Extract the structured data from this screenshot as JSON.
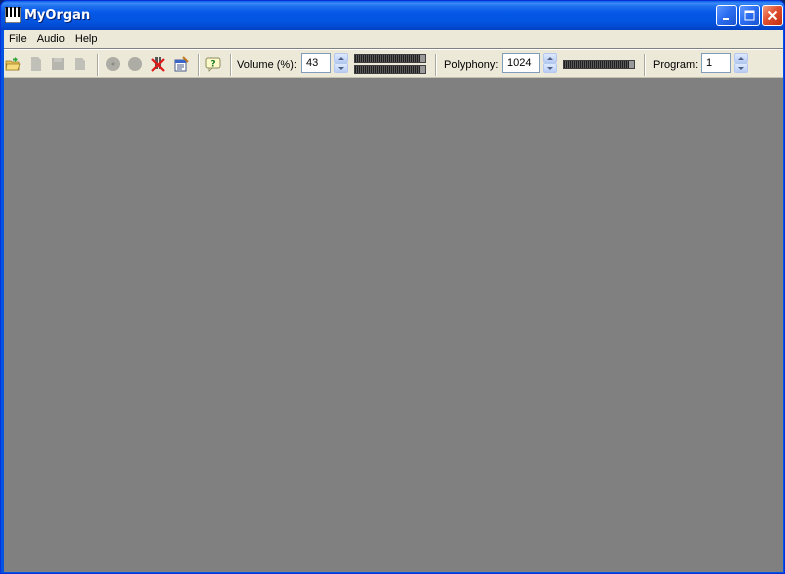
{
  "window": {
    "title": "MyOrgan"
  },
  "menu": {
    "items": [
      "File",
      "Audio",
      "Help"
    ]
  },
  "toolbar": {
    "icons": [
      "open-folder-icon",
      "new-icon",
      "save-icon",
      "document-icon",
      "record-icon",
      "stop-icon",
      "panic-icon",
      "properties-icon",
      "help-icon"
    ],
    "volume": {
      "label": "Volume (%):",
      "value": "43"
    },
    "polyphony": {
      "label": "Polyphony:",
      "value": "1024"
    },
    "program": {
      "label": "Program:",
      "value": "1"
    }
  },
  "colors": {
    "titlebar": "#0458e6",
    "workspace": "#808080",
    "chrome": "#ece9d8"
  }
}
